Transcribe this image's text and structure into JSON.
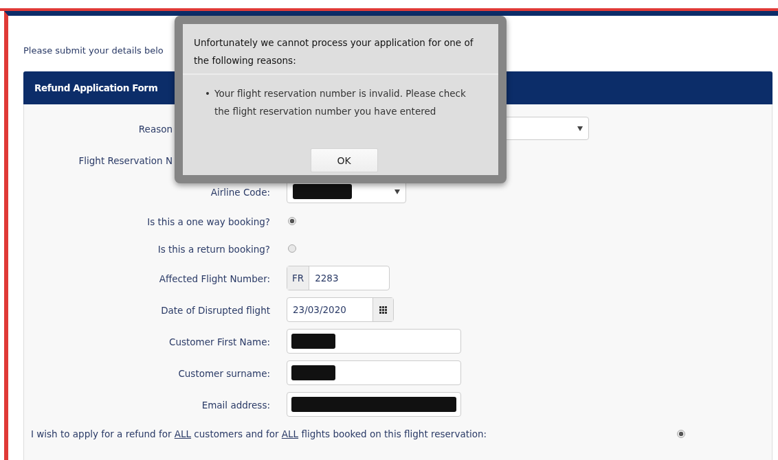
{
  "intro": "Please submit your details belo",
  "panel": {
    "title": "Refund Application Form"
  },
  "rows": [
    {
      "kind": "select",
      "label": "Reason",
      "label_cut": true
    },
    {
      "kind": "hidden",
      "label": "Flight Reservation N",
      "label_cut": true
    },
    {
      "kind": "redacted-select",
      "label": "Airline Code:"
    },
    {
      "kind": "radio",
      "label": "Is this a one way booking?",
      "selected": true
    },
    {
      "kind": "radio",
      "label": "Is this a return booking?",
      "selected": false
    },
    {
      "kind": "prefixed",
      "label": "Affected Flight Number:",
      "prefix": "FR",
      "value": "2283"
    },
    {
      "kind": "date",
      "label": "Date of Disrupted flight",
      "value": "23/03/2020"
    },
    {
      "kind": "redacted-input",
      "label": "Customer First Name:"
    },
    {
      "kind": "redacted-input",
      "label": "Customer surname:"
    },
    {
      "kind": "redacted-email",
      "label": "Email address:"
    }
  ],
  "refund_all": {
    "selected": true,
    "segments": [
      {
        "text": "I wish to apply for a refund for ",
        "underlined": false
      },
      {
        "text": "ALL",
        "underlined": true
      },
      {
        "text": " customers and for ",
        "underlined": false
      },
      {
        "text": "ALL",
        "underlined": true
      },
      {
        "text": " flights booked on this flight reservation:",
        "underlined": false
      }
    ]
  },
  "dialog": {
    "title": "Unfortunately we cannot process your application for one of the following reasons:",
    "reasons": [
      {
        "bullet": "•",
        "text": "Your flight reservation number is invalid. Please check the flight reservation number you have entered"
      }
    ],
    "button": "OK"
  }
}
